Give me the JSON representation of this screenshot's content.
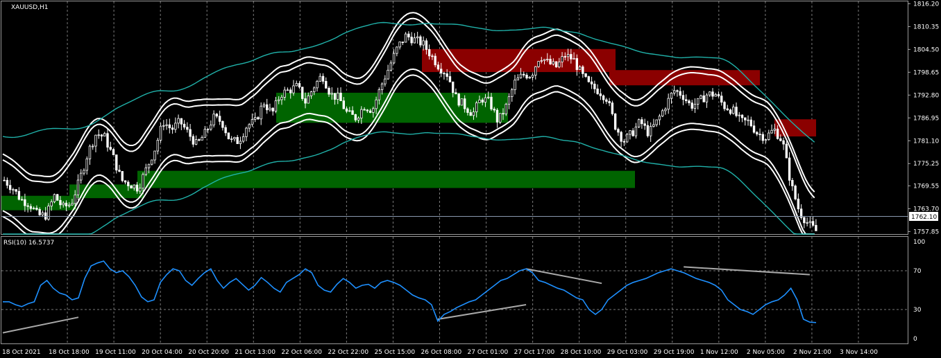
{
  "symbol_label": "XAUUSD,H1",
  "rsi_label": "RSI(10) 16.5737",
  "current_price": "1762.10",
  "colors": {
    "background": "#000000",
    "candle": "#ffffff",
    "band_white": "#ffffff",
    "band_teal": "#20b2aa",
    "demand_zone": "#006400",
    "supply_zone": "#8b0000",
    "rsi_line": "#1e90ff",
    "divergence_line": "#a9a9a9",
    "grid": "#808080"
  },
  "price_axis": {
    "ticks": [
      "1816.20",
      "1810.35",
      "1804.50",
      "1798.65",
      "1792.80",
      "1786.95",
      "1781.10",
      "1775.25",
      "1769.55",
      "1763.70",
      "1757.85"
    ],
    "range": [
      1757.2,
      1816.8
    ]
  },
  "rsi_axis": {
    "ticks": [
      "100",
      "70",
      "30",
      "0"
    ],
    "levels": [
      70,
      30
    ],
    "range": [
      0,
      100
    ]
  },
  "time_axis": {
    "labels": [
      "18 Oct 2021",
      "18 Oct 18:00",
      "19 Oct 11:00",
      "20 Oct 04:00",
      "20 Oct 20:00",
      "21 Oct 13:00",
      "22 Oct 06:00",
      "22 Oct 22:00",
      "25 Oct 15:00",
      "26 Oct 08:00",
      "27 Oct 01:00",
      "27 Oct 17:00",
      "28 Oct 10:00",
      "29 Oct 03:00",
      "29 Oct 19:00",
      "1 Nov 12:00",
      "2 Nov 05:00",
      "2 Nov 21:00",
      "3 Nov 14:00"
    ]
  },
  "chart_data": [
    {
      "type": "candlestick",
      "title": "XAUUSD,H1",
      "bars": 276,
      "close_path": [
        1771,
        1769,
        1766,
        1765,
        1762,
        1762,
        1767,
        1764,
        1765,
        1771,
        1778,
        1783,
        1782,
        1777,
        1771,
        1770,
        1769,
        1774,
        1779,
        1786,
        1784,
        1786,
        1783,
        1780,
        1783,
        1787,
        1786,
        1781,
        1781,
        1785,
        1786,
        1791,
        1788,
        1793,
        1794,
        1795,
        1791,
        1795,
        1798,
        1793,
        1792,
        1788,
        1787,
        1790,
        1789,
        1795,
        1800,
        1805,
        1808,
        1807,
        1806,
        1803,
        1800,
        1798,
        1792,
        1790,
        1788,
        1792,
        1791,
        1786,
        1790,
        1796,
        1798,
        1798,
        1803,
        1801,
        1800,
        1803,
        1802,
        1798,
        1795,
        1794,
        1792,
        1785,
        1781,
        1783,
        1786,
        1783,
        1786,
        1790,
        1794,
        1793,
        1790,
        1791,
        1793,
        1793,
        1790,
        1789,
        1786,
        1786,
        1783,
        1782,
        1784,
        1781,
        1770,
        1763,
        1760,
        1758
      ],
      "current_price": 1762.1,
      "zones": [
        {
          "kind": "demand",
          "from": 1763.3,
          "to": 1767.0
        },
        {
          "kind": "demand",
          "from": 1766.4,
          "to": 1769.9
        },
        {
          "kind": "demand",
          "from": 1769.0,
          "to": 1773.4
        },
        {
          "kind": "demand",
          "from": 1785.7,
          "to": 1793.4
        },
        {
          "kind": "supply",
          "from": 1798.7,
          "to": 1804.6
        },
        {
          "kind": "supply",
          "from": 1795.3,
          "to": 1799.2
        },
        {
          "kind": "supply",
          "from": 1782.2,
          "to": 1786.6
        }
      ]
    },
    {
      "type": "line",
      "title": "RSI(10) 16.5737",
      "ylim": [
        0,
        100
      ],
      "levels": [
        70,
        30
      ],
      "current": 16.5737,
      "values": [
        38,
        38,
        35,
        33,
        36,
        38,
        55,
        60,
        52,
        47,
        45,
        40,
        42,
        62,
        75,
        78,
        80,
        72,
        68,
        70,
        64,
        55,
        43,
        38,
        40,
        58,
        66,
        72,
        70,
        60,
        55,
        62,
        68,
        72,
        60,
        52,
        58,
        62,
        56,
        50,
        55,
        63,
        58,
        52,
        48,
        58,
        62,
        66,
        72,
        68,
        55,
        50,
        48,
        56,
        62,
        58,
        52,
        55,
        56,
        52,
        58,
        60,
        58,
        55,
        50,
        45,
        42,
        40,
        35,
        18,
        25,
        28,
        32,
        35,
        38,
        40,
        45,
        50,
        55,
        60,
        62,
        66,
        70,
        72,
        68,
        60,
        58,
        55,
        52,
        50,
        46,
        42,
        40,
        30,
        25,
        30,
        40,
        45,
        50,
        55,
        58,
        60,
        62,
        65,
        68,
        70,
        72,
        70,
        68,
        65,
        62,
        60,
        58,
        55,
        50,
        40,
        35,
        30,
        28,
        25,
        30,
        35,
        38,
        40,
        45,
        52,
        40,
        20,
        17,
        16.6
      ],
      "divergence_lines": [
        {
          "from": [
            0,
            6
          ],
          "to": [
            12,
            22
          ]
        },
        {
          "from": [
            69,
            20
          ],
          "to": [
            83,
            35
          ]
        },
        {
          "from": [
            83,
            72
          ],
          "to": [
            95,
            57
          ]
        },
        {
          "from": [
            108,
            74
          ],
          "to": [
            128,
            66
          ]
        }
      ]
    }
  ]
}
